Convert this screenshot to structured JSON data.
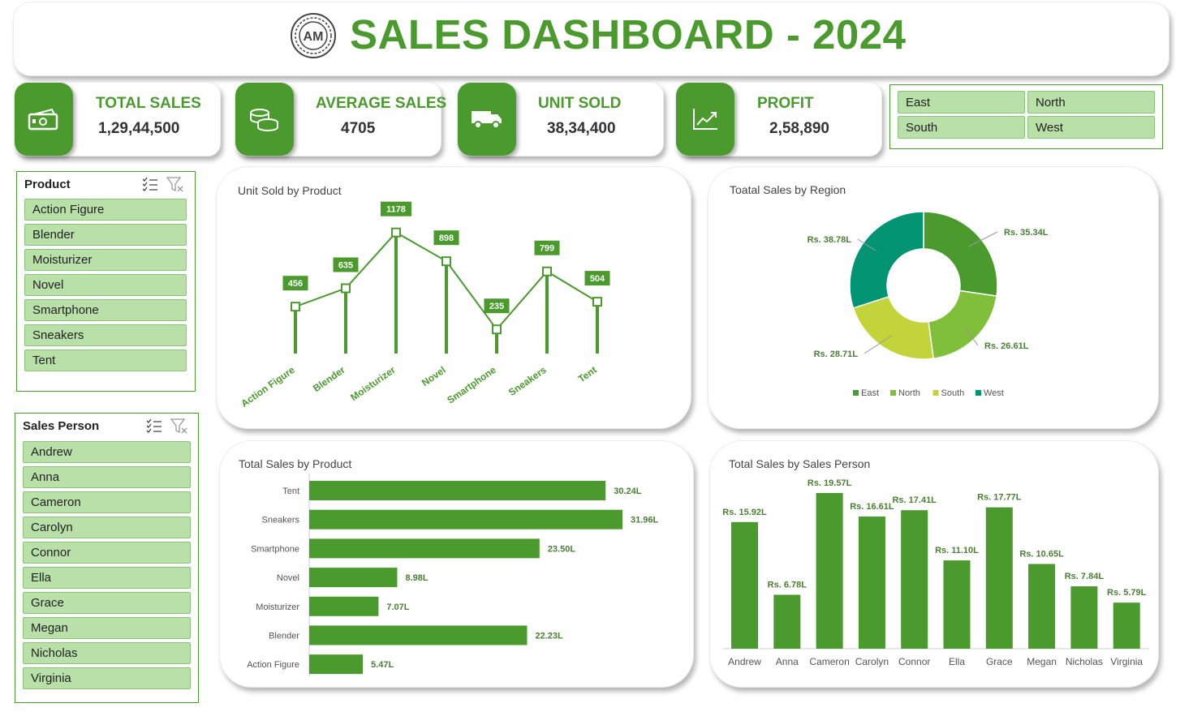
{
  "header": {
    "title": "SALES DASHBOARD - 2024",
    "logo_text": "AM"
  },
  "kpis": [
    {
      "label": "TOTAL SALES",
      "value": "1,29,44,500",
      "icon": "money-icon"
    },
    {
      "label": "AVERAGE SALES",
      "value": "4705",
      "icon": "coins-icon"
    },
    {
      "label": "UNIT SOLD",
      "value": "38,34,400",
      "icon": "truck-icon"
    },
    {
      "label": "PROFIT",
      "value": "2,58,890",
      "icon": "chart-up-icon"
    }
  ],
  "region_slicer": {
    "items": [
      "East",
      "North",
      "South",
      "West"
    ]
  },
  "product_slicer": {
    "header": "Product",
    "items": [
      "Action Figure",
      "Blender",
      "Moisturizer",
      "Novel",
      "Smartphone",
      "Sneakers",
      "Tent"
    ]
  },
  "person_slicer": {
    "header": "Sales Person",
    "items": [
      "Andrew",
      "Anna",
      "Cameron",
      "Carolyn",
      "Connor",
      "Ella",
      "Grace",
      "Megan",
      "Nicholas",
      "Virginia"
    ]
  },
  "colors": {
    "accent": "#4a9a2e",
    "slicer_fill": "#b8e0a8",
    "east": "#4a9a2e",
    "north": "#7fbf3a",
    "south": "#c3d43a",
    "west": "#009473"
  },
  "chart_data": [
    {
      "type": "line",
      "title": "Unit Sold by Product",
      "categories": [
        "Action Figure",
        "Blender",
        "Moisturizer",
        "Novel",
        "Smartphone",
        "Sneakers",
        "Tent"
      ],
      "values": [
        456,
        635,
        1178,
        898,
        235,
        799,
        504
      ],
      "data_labels": [
        "456",
        "635",
        "1178",
        "898",
        "235",
        "799",
        "504"
      ],
      "ylim": [
        0,
        1300
      ]
    },
    {
      "type": "pie",
      "title": "Toatal Sales by Region",
      "categories": [
        "East",
        "North",
        "South",
        "West"
      ],
      "values": [
        35.34,
        26.61,
        28.71,
        38.78
      ],
      "data_labels": [
        "Rs. 35.34L",
        "Rs. 26.61L",
        "Rs. 28.71L",
        "Rs. 38.78L"
      ],
      "legend": "bottom"
    },
    {
      "type": "bar",
      "title": "Total Sales by Product",
      "categories": [
        "Tent",
        "Sneakers",
        "Smartphone",
        "Novel",
        "Moisturizer",
        "Blender",
        "Action Figure"
      ],
      "values": [
        30.24,
        31.96,
        23.5,
        8.98,
        7.07,
        22.23,
        5.47
      ],
      "data_labels": [
        "30.24L",
        "31.96L",
        "23.50L",
        "8.98L",
        "7.07L",
        "22.23L",
        "5.47L"
      ],
      "ylim": [
        0,
        35
      ]
    },
    {
      "type": "bar",
      "title": "Total Sales by Sales Person",
      "categories": [
        "Andrew",
        "Anna",
        "Cameron",
        "Carolyn",
        "Connor",
        "Ella",
        "Grace",
        "Megan",
        "Nicholas",
        "Virginia"
      ],
      "values": [
        15.92,
        6.78,
        19.57,
        16.61,
        17.41,
        11.1,
        17.77,
        10.65,
        7.84,
        5.79
      ],
      "data_labels": [
        "Rs. 15.92L",
        "Rs. 6.78L",
        "Rs. 19.57L",
        "Rs. 16.61L",
        "Rs. 17.41L",
        "Rs. 11.10L",
        "Rs. 17.77L",
        "Rs. 10.65L",
        "Rs. 7.84L",
        "Rs. 5.79L"
      ],
      "ylim": [
        0,
        20
      ]
    }
  ]
}
